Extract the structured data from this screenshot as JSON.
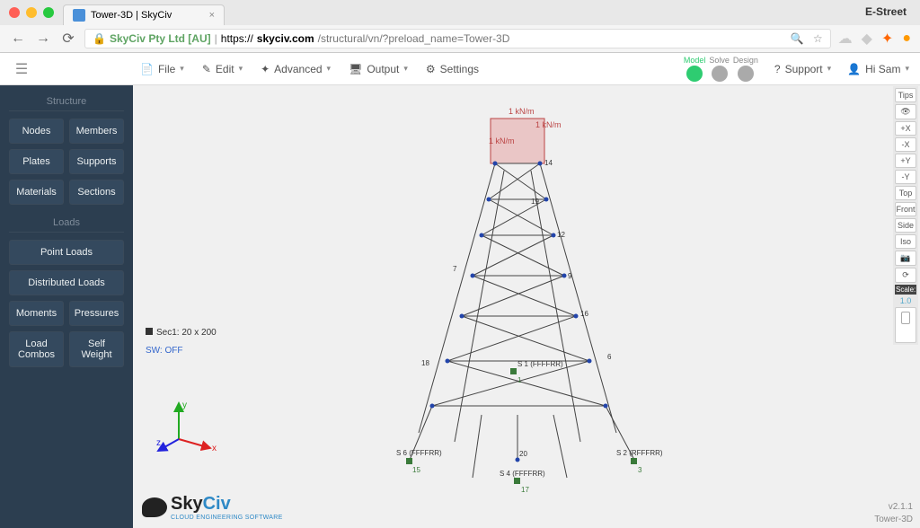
{
  "browser": {
    "tab_title": "Tower-3D | SkyCiv",
    "profile": "E-Street",
    "url_company": "SkyCiv Pty Ltd [AU]",
    "url_proto": "https://",
    "url_domain": "skyciv.com",
    "url_path": "/structural/vn/?preload_name=Tower-3D"
  },
  "toolbar": {
    "file": "File",
    "edit": "Edit",
    "advanced": "Advanced",
    "output": "Output",
    "settings": "Settings",
    "support": "Support",
    "user": "Hi Sam",
    "modes": {
      "model": "Model",
      "solve": "Solve",
      "design": "Design"
    }
  },
  "sidebar": {
    "structure": "Structure",
    "nodes": "Nodes",
    "members": "Members",
    "plates": "Plates",
    "supports": "Supports",
    "materials": "Materials",
    "sections": "Sections",
    "loads": "Loads",
    "point_loads": "Point Loads",
    "dist_loads": "Distributed Loads",
    "moments": "Moments",
    "pressures": "Pressures",
    "load_combos": "Load Combos",
    "self_weight": "Self Weight"
  },
  "canvas": {
    "legend": "Sec1: 20 x 200",
    "sw": "SW: OFF",
    "load_label": "1 kN/m",
    "logo_brand": "Sky",
    "logo_brand2": "Civ",
    "logo_sub": "CLOUD ENGINEERING SOFTWARE",
    "version": "v2.1.1",
    "filename": "Tower-3D",
    "support_label1": "S 6 (FFFFRR)",
    "support_label2": "S 1 (FFFFRR)",
    "support_label3": "S 2 (RFFFRR)",
    "support_label4": "S 4 (FFFFRR)"
  },
  "right_tools": {
    "tips": "Tips",
    "eye": "👁",
    "plus_x": "+X",
    "minus_x": "-X",
    "plus_y": "+Y",
    "minus_y": "-Y",
    "top": "Top",
    "front": "Front",
    "side": "Side",
    "iso": "Iso",
    "cam": "📷",
    "refresh": "⟳",
    "scale": "Scale:",
    "scale_val": "1.0"
  }
}
